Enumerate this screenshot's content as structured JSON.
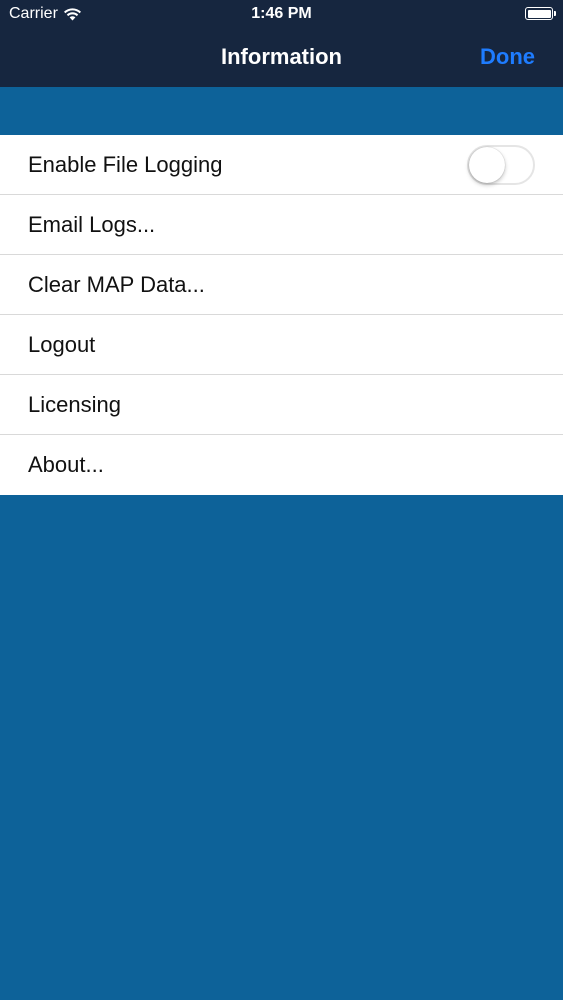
{
  "status_bar": {
    "carrier": "Carrier",
    "time": "1:46 PM",
    "wifi_icon": "wifi-icon",
    "battery_icon": "battery-icon"
  },
  "nav": {
    "title": "Information",
    "done_label": "Done"
  },
  "menu": {
    "items": [
      {
        "label": "Enable File Logging",
        "toggle": {
          "on": false
        }
      },
      {
        "label": "Email Logs..."
      },
      {
        "label": "Clear MAP Data..."
      },
      {
        "label": "Logout"
      },
      {
        "label": "Licensing"
      },
      {
        "label": "About..."
      }
    ]
  },
  "colors": {
    "nav_background": "#16263f",
    "page_background": "#0d6299",
    "accent": "#1e7cff"
  }
}
